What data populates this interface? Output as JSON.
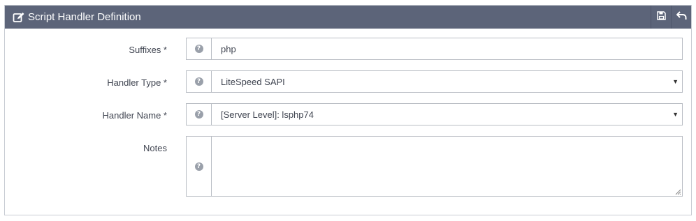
{
  "panel": {
    "title": "Script Handler Definition",
    "title_icon": "edit-icon",
    "actions": [
      {
        "name": "save-icon"
      },
      {
        "name": "back-icon"
      }
    ]
  },
  "fields": {
    "suffixes": {
      "label": "Suffixes *",
      "value": "php",
      "help": "?"
    },
    "handler_type": {
      "label": "Handler Type *",
      "value": "LiteSpeed SAPI",
      "help": "?"
    },
    "handler_name": {
      "label": "Handler Name *",
      "value": "[Server Level]: lsphp74",
      "help": "?"
    },
    "notes": {
      "label": "Notes",
      "value": "",
      "help": "?"
    }
  },
  "colors": {
    "header_bg": "#5c6479",
    "border": "#b9bdc4",
    "label_text": "#404551"
  }
}
